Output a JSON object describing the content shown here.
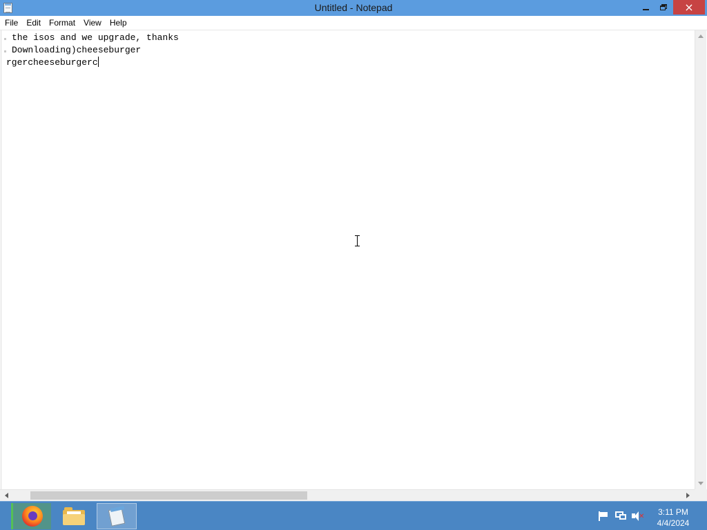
{
  "window": {
    "title": "Untitled - Notepad",
    "app_icon": "notepad-icon",
    "controls": {
      "minimize": "minimize-icon",
      "restore": "restore-icon",
      "close": "×"
    }
  },
  "menu": {
    "items": [
      {
        "label": "File"
      },
      {
        "label": "Edit"
      },
      {
        "label": "Format"
      },
      {
        "label": "View"
      },
      {
        "label": "Help"
      }
    ]
  },
  "editor": {
    "lines": [
      "the isos and we upgrade, thanks",
      "Downloading)cheeseburger",
      "rgercheeseburgerc"
    ],
    "caret_after_line": 3
  },
  "taskbar": {
    "apps": [
      {
        "name": "Firefox",
        "icon": "firefox-icon",
        "active": false
      },
      {
        "name": "File Explorer",
        "icon": "folder-icon",
        "active": false
      },
      {
        "name": "Notepad",
        "icon": "notepad-icon",
        "active": true
      }
    ],
    "tray": {
      "icons": [
        "flag-icon",
        "network-icon",
        "volume-muted-icon"
      ],
      "time": "3:11 PM",
      "date": "4/4/2024"
    }
  },
  "colors": {
    "titlebar": "#5b9cdf",
    "close_button": "#c74343",
    "taskbar": "#4a86c4"
  }
}
